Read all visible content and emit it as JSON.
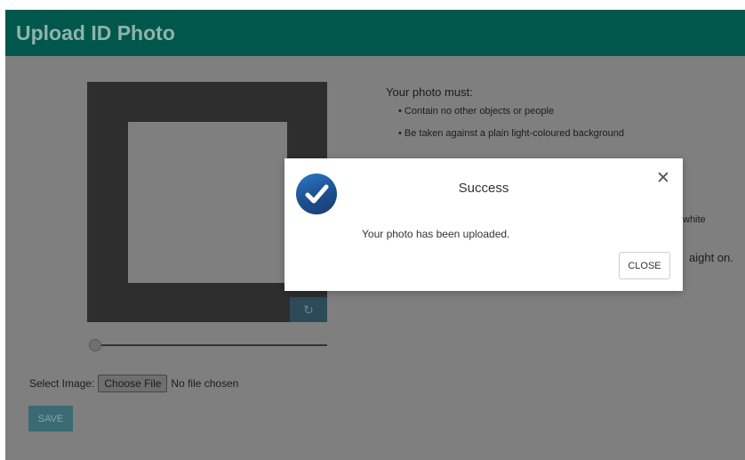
{
  "header": {
    "title": "Upload ID Photo"
  },
  "cropper": {
    "zoom_level": 0
  },
  "select_image": {
    "label": "Select Image:",
    "button_label": "Choose File",
    "status": "No file chosen"
  },
  "save_label": "SAVE",
  "requirements": {
    "title": "Your photo must:",
    "items": [
      "Contain no other objects or people",
      "Be taken against a plain light-coloured background"
    ],
    "partial_line_1": "white",
    "partial_line_2": "aight on."
  },
  "modal": {
    "title": "Success",
    "message": "Your photo has been uploaded.",
    "close_label": "CLOSE",
    "close_icon": "close-icon",
    "success_icon": "checkmark-circle-icon"
  },
  "colors": {
    "header_bg": "#01574b",
    "overlay": "#7f7f7f",
    "success_icon": "#2a6fb8"
  }
}
